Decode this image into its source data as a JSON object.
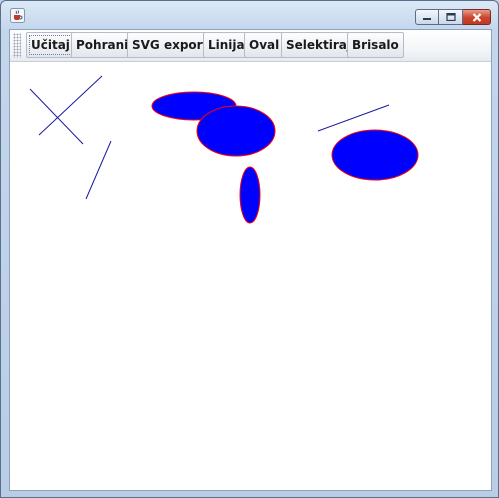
{
  "window": {
    "title": "",
    "controls": [
      "minimize",
      "maximize",
      "close"
    ],
    "icon": "java-cup-icon"
  },
  "toolbar": {
    "buttons": [
      {
        "id": "ucitaj",
        "label": "Učitaj"
      },
      {
        "id": "pohrani",
        "label": "Pohrani"
      },
      {
        "id": "svg-export",
        "label": "SVG export"
      },
      {
        "id": "linija",
        "label": "Linija"
      },
      {
        "id": "oval",
        "label": "Oval"
      },
      {
        "id": "selektiraj",
        "label": "Selektiraj"
      },
      {
        "id": "brisalo",
        "label": "Brisalo"
      }
    ],
    "focused": "ucitaj"
  },
  "colors": {
    "line_stroke": "#1a1a9c",
    "oval_fill": "#0000ff",
    "oval_stroke": "#ff0000"
  },
  "canvas": {
    "shape_count": 9,
    "lines": 4,
    "ovals": 5
  }
}
